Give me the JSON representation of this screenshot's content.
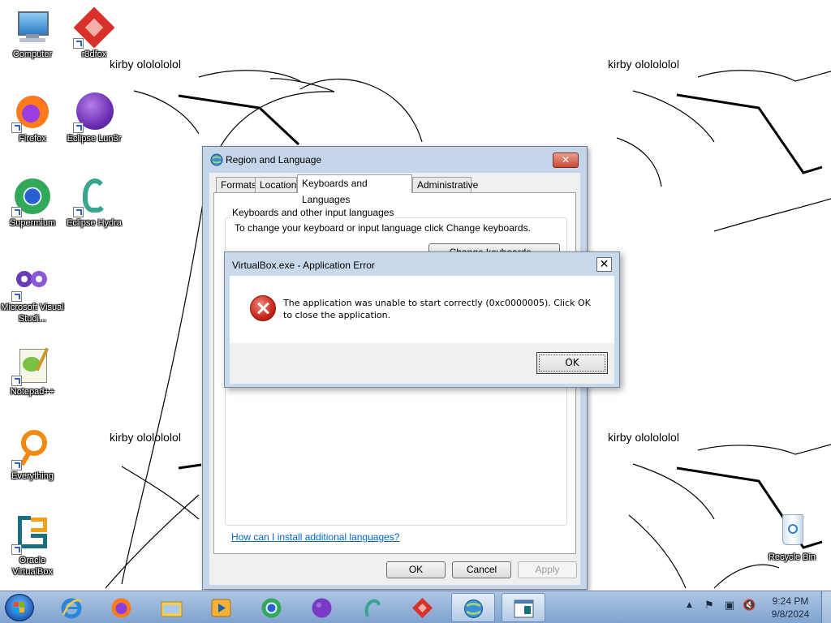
{
  "wallpaper": {
    "caption": "kirby ololololol"
  },
  "desktop_icons": [
    {
      "label": "Computer"
    },
    {
      "label": "r3dfox"
    },
    {
      "label": "Firefox"
    },
    {
      "label": "Eclipse Lun3r"
    },
    {
      "label": "Supermium"
    },
    {
      "label": "Eclipse Hydra"
    },
    {
      "label": "Microsoft Visual Studi..."
    },
    {
      "label": "Notepad++"
    },
    {
      "label": "Everything"
    },
    {
      "label": "Oracle VirtualBox"
    },
    {
      "label": "Recycle Bin"
    }
  ],
  "region_window": {
    "title": "Region and Language",
    "tabs": [
      {
        "label": "Formats"
      },
      {
        "label": "Location"
      },
      {
        "label": "Keyboards and Languages",
        "active": true
      },
      {
        "label": "Administrative"
      }
    ],
    "group_title": "Keyboards and other input languages",
    "group_description": "To change your keyboard or input language click Change keyboards.",
    "change_keyboards_label": "Change keyboards...",
    "help_link": "How can I install additional languages?",
    "buttons": {
      "ok": "OK",
      "cancel": "Cancel",
      "apply": "Apply"
    }
  },
  "error_dialog": {
    "title": "VirtualBox.exe - Application Error",
    "message": "The application was unable to start correctly (0xc0000005). Click OK to close the application.",
    "ok_label": "OK",
    "close_glyph": "✕",
    "icon": "error-icon"
  },
  "taskbar": {
    "pinned": [
      {
        "name": "internet-explorer-icon"
      },
      {
        "name": "firefox-icon"
      },
      {
        "name": "file-explorer-icon"
      },
      {
        "name": "media-player-icon"
      },
      {
        "name": "supermium-icon"
      },
      {
        "name": "eclipse-lun3r-icon"
      },
      {
        "name": "eclipse-hydra-icon"
      },
      {
        "name": "r3dfox-icon"
      },
      {
        "name": "region-language-icon",
        "active": true
      },
      {
        "name": "virtualbox-window-icon",
        "active": true
      }
    ],
    "clock": {
      "time": "9:24 PM",
      "date": "9/8/2024"
    },
    "tray": {
      "arrow": "▲",
      "flag": "⚑",
      "network": "▣",
      "volume": "🔇"
    }
  },
  "colors": {
    "taskbar": "#7fa3cf",
    "dialog_frame": "#c9d9ec",
    "link": "#0066cc",
    "error_red": "#c8261a"
  }
}
